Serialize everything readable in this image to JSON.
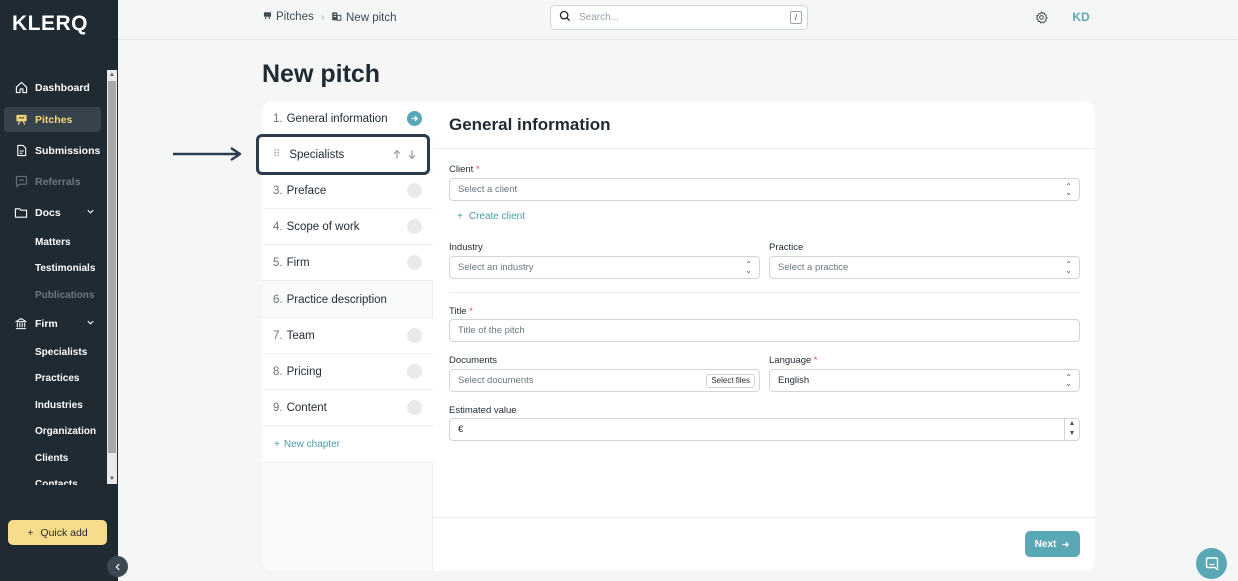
{
  "app": {
    "logo": "KLERQ"
  },
  "sidebar": {
    "items": [
      {
        "label": "Dashboard",
        "icon": "home-icon"
      },
      {
        "label": "Pitches",
        "icon": "pitch-icon",
        "active": true
      },
      {
        "label": "Submissions",
        "icon": "document-icon"
      },
      {
        "label": "Referrals",
        "icon": "chat-icon",
        "disabled": true
      },
      {
        "label": "Docs",
        "icon": "folder-icon"
      },
      {
        "label": "Firm",
        "icon": "bank-icon"
      }
    ],
    "docs_children": [
      "Matters",
      "Testimonials",
      "Publications"
    ],
    "firm_children": [
      "Specialists",
      "Practices",
      "Industries",
      "Organization",
      "Clients",
      "Contacts"
    ],
    "quick_add_label": "Quick add"
  },
  "header": {
    "breadcrumb": [
      "Pitches",
      "New pitch"
    ],
    "search_placeholder": "Search...",
    "search_shortcut": "/",
    "user_initials": "KD"
  },
  "page": {
    "title": "New pitch"
  },
  "chapters": [
    {
      "num": "1.",
      "label": "General information",
      "state": "current"
    },
    {
      "num": "",
      "label": "Specialists",
      "state": "dragging"
    },
    {
      "num": "3.",
      "label": "Preface",
      "state": "todo"
    },
    {
      "num": "4.",
      "label": "Scope of work",
      "state": "todo"
    },
    {
      "num": "5.",
      "label": "Firm",
      "state": "todo"
    },
    {
      "num": "6.",
      "label": "Practice description",
      "state": "none"
    },
    {
      "num": "7.",
      "label": "Team",
      "state": "todo"
    },
    {
      "num": "8.",
      "label": "Pricing",
      "state": "todo"
    },
    {
      "num": "9.",
      "label": "Content",
      "state": "todo"
    }
  ],
  "new_chapter_label": "New chapter",
  "form": {
    "title": "General information",
    "client_label": "Client",
    "client_placeholder": "Select a client",
    "create_client_label": "Create client",
    "industry_label": "Industry",
    "industry_placeholder": "Select an industry",
    "practice_label": "Practice",
    "practice_placeholder": "Select a practice",
    "title_label": "Title",
    "title_placeholder": "Title of the pitch",
    "documents_label": "Documents",
    "documents_placeholder": "Select documents",
    "select_files_label": "Select files",
    "language_label": "Language",
    "language_value": "English",
    "estimated_value_label": "Estimated value",
    "currency_symbol": "€",
    "required_mark": "*",
    "next_label": "Next"
  },
  "colors": {
    "sidebar_bg": "#1f2a33",
    "accent": "#5aa7b6",
    "active_text": "#f4d77a",
    "quick_add_bg": "#f7dc8c"
  }
}
